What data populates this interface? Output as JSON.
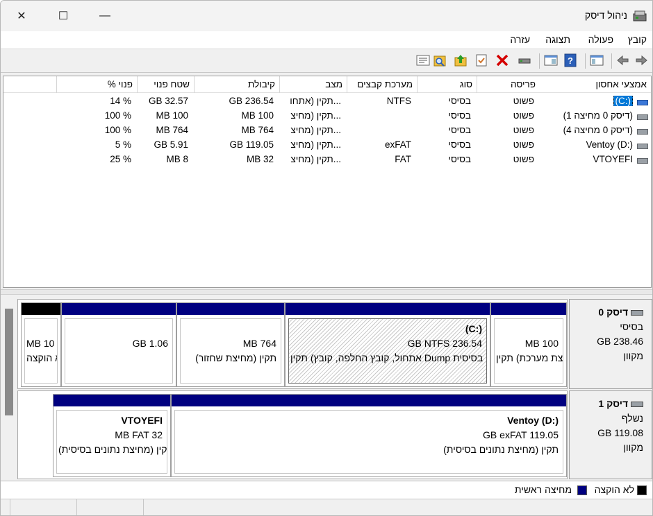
{
  "window": {
    "title": "ניהול דיסק",
    "minimize_glyph": "—",
    "maximize_glyph": "☐",
    "close_glyph": "✕"
  },
  "menu": [
    "קובץ",
    "פעולה",
    "תצוגה",
    "עזרה"
  ],
  "toolbar": {
    "icons": [
      "back-arrow-icon",
      "forward-arrow-icon",
      "show-hide-console-tree-icon",
      "help-icon",
      "properties-icon",
      "connect-disk-icon",
      "delete-icon",
      "check-icon",
      "up-icon",
      "search-icon",
      "properties-list-icon"
    ]
  },
  "volume_list": {
    "columns": [
      "אמצעי אחסון",
      "פריסה",
      "סוג",
      "מערכת קבצים",
      "מצב",
      "קיבולת",
      "שטח פנוי",
      "% פנוי"
    ],
    "rows": [
      {
        "name": "(C:)",
        "layout": "פשוט",
        "type": "בסיסי",
        "fs": "NTFS",
        "status": "תקין (אתחו...",
        "capacity": "GB 236.54",
        "free": "GB 32.57",
        "pct": "14 %",
        "selected": true
      },
      {
        "name": "(דיסק 0 מחיצה 1)",
        "layout": "פשוט",
        "type": "בסיסי",
        "fs": "",
        "status": "תקין (מחיצ...",
        "capacity": "MB 100",
        "free": "MB 100",
        "pct": "100 %",
        "selected": false
      },
      {
        "name": "(דיסק 0 מחיצה 4)",
        "layout": "פשוט",
        "type": "בסיסי",
        "fs": "",
        "status": "תקין (מחיצ...",
        "capacity": "MB 764",
        "free": "MB 764",
        "pct": "100 %",
        "selected": false
      },
      {
        "name": "Ventoy (D:)",
        "layout": "פשוט",
        "type": "בסיסי",
        "fs": "exFAT",
        "status": "תקין (מחיצ...",
        "capacity": "GB 119.05",
        "free": "GB 5.91",
        "pct": "5 %",
        "selected": false
      },
      {
        "name": "VTOYEFI",
        "layout": "פשוט",
        "type": "בסיסי",
        "fs": "FAT",
        "status": "תקין (מחיצ...",
        "capacity": "MB 32",
        "free": "MB 8",
        "pct": "25 %",
        "selected": false
      }
    ]
  },
  "disks": [
    {
      "title": "דיסק 0",
      "kind": "בסיסי",
      "size": "GB 238.46",
      "state": "מקוון",
      "partitions": [
        {
          "title": "",
          "line1": "MB 100",
          "line2": "תקין (מחיצת מערכת EFI)",
          "bar": "primary",
          "hatched": false
        },
        {
          "title": "(C:)",
          "line1": "GB NTFS 236.54",
          "line2": "תקין (אתחול, קובץ החלפה, קובץ Dump של קריסה, מחיצת נתונים בסיסית)",
          "bar": "primary",
          "hatched": true
        },
        {
          "title": "",
          "line1": "MB 764",
          "line2": "תקין (מחיצת שחזור)",
          "bar": "primary",
          "hatched": false
        },
        {
          "title": "",
          "line1": "GB 1.06",
          "line2": "",
          "bar": "primary",
          "hatched": false
        },
        {
          "title": "",
          "line1": "MB 10",
          "line2": "לא הוקצה",
          "bar": "unalloc",
          "hatched": false
        }
      ]
    },
    {
      "title": "דיסק 1",
      "kind": "נשלף",
      "size": "GB 119.08",
      "state": "מקוון",
      "partitions": [
        {
          "title": "Ventoy  (D:)",
          "line1": "GB exFAT 119.05",
          "line2": "תקין (מחיצת נתונים בסיסית)",
          "bar": "primary",
          "hatched": false
        },
        {
          "title": "VTOYEFI",
          "line1": "MB FAT 32",
          "line2": "תקין (מחיצת נתונים בסיסית)",
          "bar": "primary",
          "hatched": false
        }
      ]
    }
  ],
  "legend": [
    {
      "label": "לא הוקצה",
      "color": "#000000"
    },
    {
      "label": "מחיצה ראשית",
      "color": "#000080"
    }
  ],
  "colors": {
    "selection": "#0078d7",
    "primary_partition": "#000080",
    "unallocated": "#000000"
  }
}
